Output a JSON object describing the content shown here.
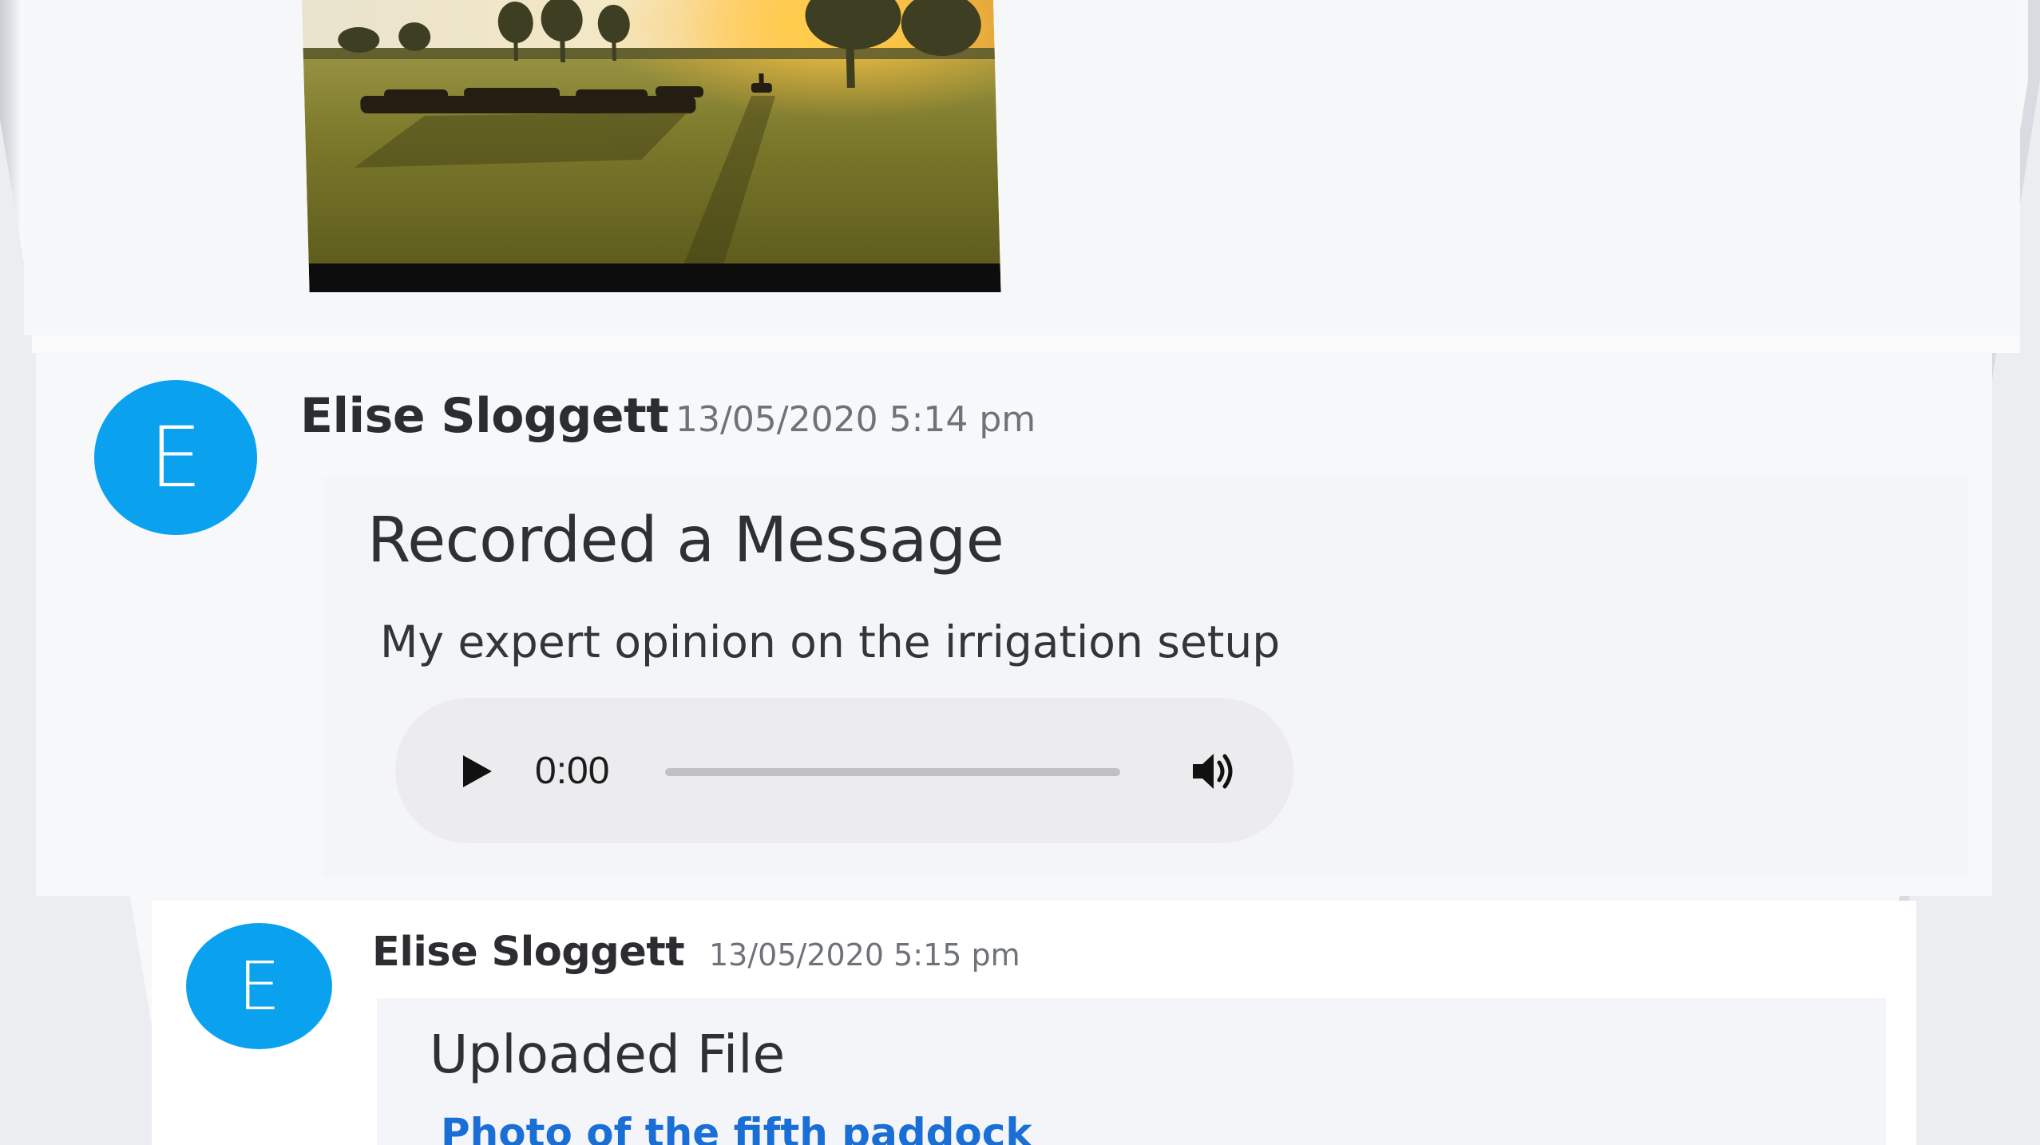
{
  "feed": {
    "messages": [
      {
        "avatar_letter": "E",
        "author": "Elise Sloggett",
        "timestamp": "13/05/2020 5:14 pm",
        "title": "Recorded a Message",
        "description": "My expert opinion on the irrigation setup",
        "audio": {
          "current_time": "0:00",
          "progress": 0,
          "play_icon": "play-icon",
          "volume_icon": "volume-icon"
        }
      },
      {
        "avatar_letter": "E",
        "author": "Elise Sloggett",
        "timestamp": "13/05/2020 5:15 pm",
        "title": "Uploaded File",
        "file_link": "Photo of the fifth paddock"
      }
    ]
  },
  "colors": {
    "avatar": "#0aa2ee",
    "link": "#1a6fd6",
    "author_text": "#2b2d31",
    "timestamp_text": "#6f7379"
  }
}
